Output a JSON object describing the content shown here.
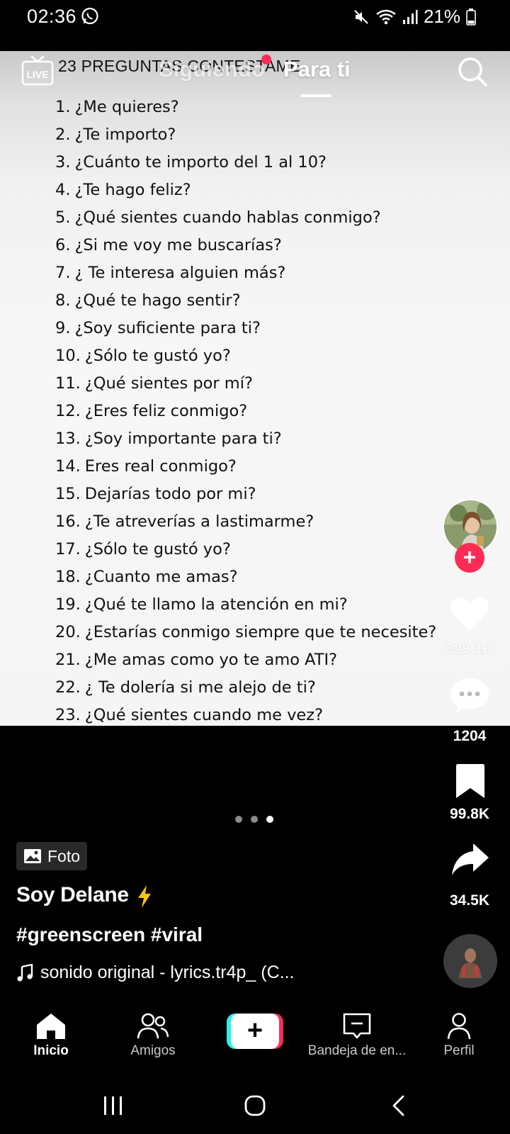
{
  "status_bar": {
    "time": "02:36",
    "battery": "21%"
  },
  "photo": {
    "title": "23 PREGUNTAS CONTESTAME",
    "questions": [
      {
        "num": "1.",
        "text": "¿Me quieres?"
      },
      {
        "num": "2.",
        "text": "¿Te importo?"
      },
      {
        "num": "3.",
        "text": "¿Cuánto te importo del 1 al 10?"
      },
      {
        "num": "4.",
        "text": "¿Te hago feliz?"
      },
      {
        "num": "5.",
        "text": "¿Qué sientes cuando hablas conmigo?"
      },
      {
        "num": "6.",
        "text": "¿Si me voy me buscarías?"
      },
      {
        "num": "7.",
        "text": "¿ Te interesa alguien más?"
      },
      {
        "num": "8.",
        "text": "¿Qué te hago sentir?"
      },
      {
        "num": "9.",
        "text": "¿Soy suficiente para ti?"
      },
      {
        "num": "10.",
        "text": "¿Sólo te gustó yo?"
      },
      {
        "num": "11.",
        "text": "¿Qué sientes por mí?"
      },
      {
        "num": "12.",
        "text": "¿Eres feliz conmigo?"
      },
      {
        "num": "13.",
        "text": "¿Soy importante para ti?"
      },
      {
        "num": "14.",
        "text": "Eres real conmigo?"
      },
      {
        "num": "15.",
        "text": "Dejarías todo por mi?"
      },
      {
        "num": "16.",
        "text": "¿Te atreverías a lastimarme?"
      },
      {
        "num": "17.",
        "text": "¿Sólo te gustó yo?"
      },
      {
        "num": "18.",
        "text": "¿Cuanto me amas?"
      },
      {
        "num": "19.",
        "text": "¿Qué te llamo la atención en mi?"
      },
      {
        "num": "20.",
        "text": "¿Estarías conmigo siempre que te necesite?"
      },
      {
        "num": "21.",
        "text": "¿Me amas como yo te amo ATI?"
      },
      {
        "num": "22.",
        "text": "¿ Te dolería si me alejo de ti?"
      },
      {
        "num": "23.",
        "text": "¿Qué sientes cuando me vez?"
      }
    ]
  },
  "top_nav": {
    "live_icon": "live-tv-icon",
    "tabs": [
      {
        "label": "Siguiendo",
        "active": false
      },
      {
        "label": "Para ti",
        "active": true
      }
    ],
    "search_icon": "search-icon"
  },
  "actions": {
    "likes": "329.1K",
    "comments": "1204",
    "saves": "99.8K",
    "shares": "34.5K"
  },
  "post": {
    "badge": "Foto",
    "author": "Soy Delane",
    "hashtags": "#greenscreen #viral",
    "sound": "sonido original - lyrics.tr4p_ (C..."
  },
  "carousel": {
    "count": 3,
    "active_index": 3
  },
  "tabbar": {
    "items": [
      {
        "label": "Inicio",
        "icon": "home-icon",
        "active": true
      },
      {
        "label": "Amigos",
        "icon": "friends-icon",
        "active": false
      },
      {
        "label": "",
        "icon": "plus-icon",
        "active": false
      },
      {
        "label": "Bandeja de en...",
        "icon": "inbox-icon",
        "active": false
      },
      {
        "label": "Perfil",
        "icon": "profile-icon",
        "active": false
      }
    ]
  },
  "colors": {
    "accent": "#fe2c55",
    "cyan": "#25f4ee",
    "background": "#000000"
  }
}
